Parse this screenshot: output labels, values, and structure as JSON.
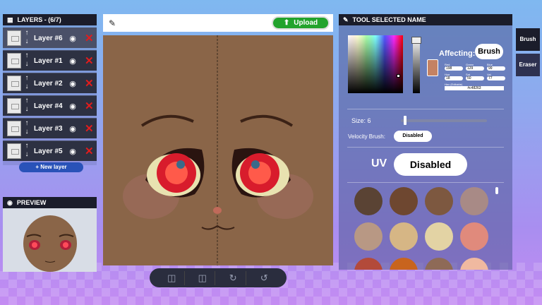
{
  "layers_panel": {
    "title": "LAYERS - (6/7)",
    "items": [
      {
        "name": "Layer #6",
        "selected": true
      },
      {
        "name": "Layer #1",
        "selected": false
      },
      {
        "name": "Layer #2",
        "selected": false
      },
      {
        "name": "Layer #4",
        "selected": false
      },
      {
        "name": "Layer #3",
        "selected": false
      },
      {
        "name": "Layer #5",
        "selected": false
      }
    ],
    "new_layer_label": "+ New layer"
  },
  "preview_panel": {
    "title": "PREVIEW"
  },
  "topbar": {
    "upload_label": "Upload"
  },
  "tool_panel": {
    "title": "TOOL SELECTED NAME",
    "affecting_label": "Affecting:",
    "affecting_value": "Brush",
    "color": {
      "red_label": "Red",
      "red": "198",
      "green_label": "Green",
      "green": "129",
      "blue_label": "Blue",
      "blue": "99",
      "hue_label": "Hue",
      "hue": "18",
      "sat_label": "Sat",
      "sat": "50",
      "val_label": "Val",
      "val": "77",
      "hex_label": "Hex (Editable)",
      "hex": "#c48263",
      "swatch_color": "#c48263"
    },
    "size_label": "Size: 6",
    "size_fraction": 0.05,
    "velocity_label": "Velocity Brush:",
    "velocity_value": "Disabled",
    "uv_label": "UV",
    "uv_value": "Disabled",
    "palette": [
      "#5a4334",
      "#6e4730",
      "#7d5840",
      "#a88a86",
      "#b89884",
      "#d6b685",
      "#e3d3a4",
      "#e08a7c",
      "#b34a3a",
      "#c8641e",
      "#8e6a57",
      "#f0b9a0"
    ]
  },
  "side_tabs": {
    "brush": "Brush",
    "eraser": "Eraser"
  },
  "canvas": {
    "skin_color": "#8a6548"
  }
}
